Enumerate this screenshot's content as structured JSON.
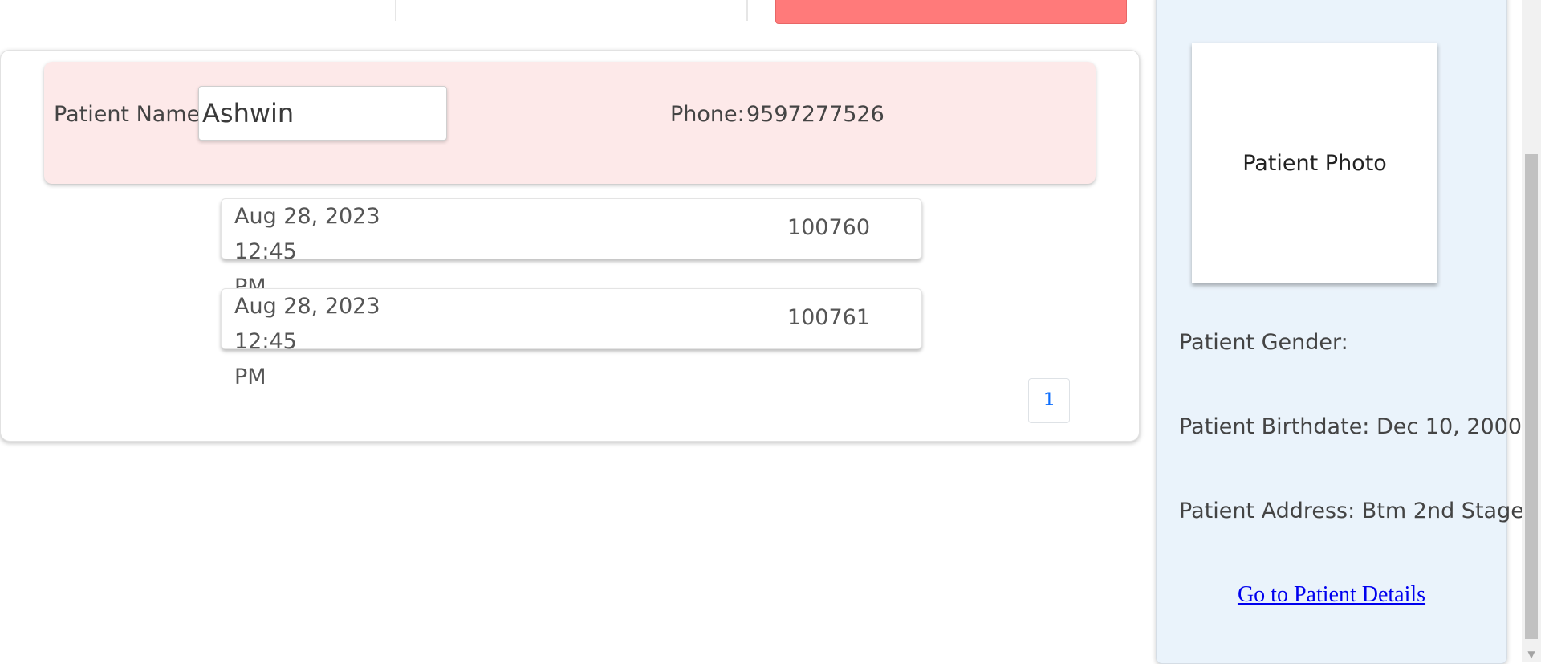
{
  "patient_card": {
    "name_label": "Patient Name:",
    "name_value": "Ashwin",
    "phone_label": "Phone:",
    "phone_value": "9597277526"
  },
  "visits": [
    {
      "date_line1": "Aug 28, 2023 12:45",
      "date_line2": "PM",
      "id": "100760"
    },
    {
      "date_line1": "Aug 28, 2023 12:45",
      "date_line2": "PM",
      "id": "100761"
    }
  ],
  "pagination": {
    "current_page": "1"
  },
  "sidebar": {
    "photo_label": "Patient Photo",
    "gender": "Patient Gender:",
    "birthdate": "Patient Birthdate: Dec 10, 2000",
    "address": "Patient Address: Btm 2nd Stage",
    "details_link": "Go to Patient Details"
  },
  "colors": {
    "top_button": "#ff7a7a",
    "patient_band": "#fde9e9",
    "sidebar_bg": "#eaf3fb",
    "link": "#0000ee",
    "pagination_text": "#0d6efd"
  },
  "icons": {
    "scroll_down": "triangle-down-icon"
  }
}
